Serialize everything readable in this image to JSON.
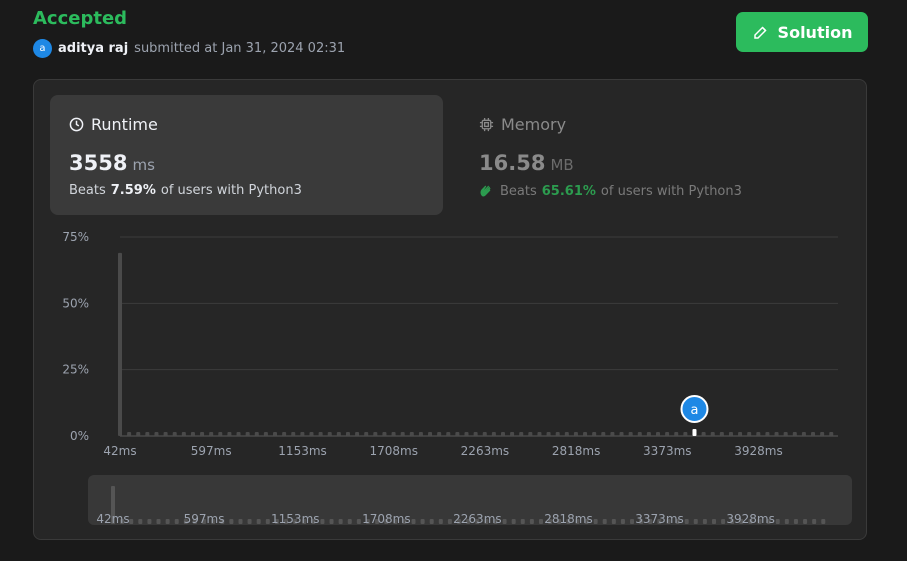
{
  "status": "Accepted",
  "submission": {
    "avatar_letter": "a",
    "username": "aditya raj",
    "submitted_text": "submitted at Jan 31, 2024 02:31"
  },
  "solution_button": {
    "label": "Solution",
    "icon": "edit-icon"
  },
  "runtime": {
    "title": "Runtime",
    "icon": "clock-icon",
    "value": "3558",
    "unit": "ms",
    "beats_prefix": "Beats",
    "beats_pct": "7.59%",
    "beats_suffix": "of users with Python3"
  },
  "memory": {
    "title": "Memory",
    "icon": "chip-icon",
    "value": "16.58",
    "unit": "MB",
    "beats_icon": "clapping-hands-icon",
    "beats_prefix": "Beats",
    "beats_pct": "65.61%",
    "beats_suffix": "of users with Python3"
  },
  "colors": {
    "accent": "#2cbb5d",
    "avatar": "#1e88e5",
    "bar": "#4a4a4a",
    "highlight": "#ffffff"
  },
  "chart_data": {
    "type": "bar",
    "title": "",
    "xlabel": "",
    "ylabel": "",
    "ylim": [
      0,
      75
    ],
    "yticks": [
      "0%",
      "25%",
      "50%",
      "75%"
    ],
    "ytick_values": [
      0,
      25,
      50,
      75
    ],
    "xticks": [
      "42ms",
      "597ms",
      "1153ms",
      "1708ms",
      "2263ms",
      "2818ms",
      "3373ms",
      "3928ms"
    ],
    "xtick_values": [
      42,
      597,
      1153,
      1708,
      2263,
      2818,
      3373,
      3928
    ],
    "xlim": [
      42,
      4412
    ],
    "bin_width_ms": 55.5,
    "peak_value_pct": 69,
    "baseline_value_pct": 1.5,
    "bin_count": 79,
    "user_marker": {
      "label": "a",
      "runtime_ms": 3558
    },
    "grid": true
  },
  "overview_chart": {
    "xticks": [
      "42ms",
      "597ms",
      "1153ms",
      "1708ms",
      "2263ms",
      "2818ms",
      "3373ms",
      "3928ms"
    ]
  }
}
